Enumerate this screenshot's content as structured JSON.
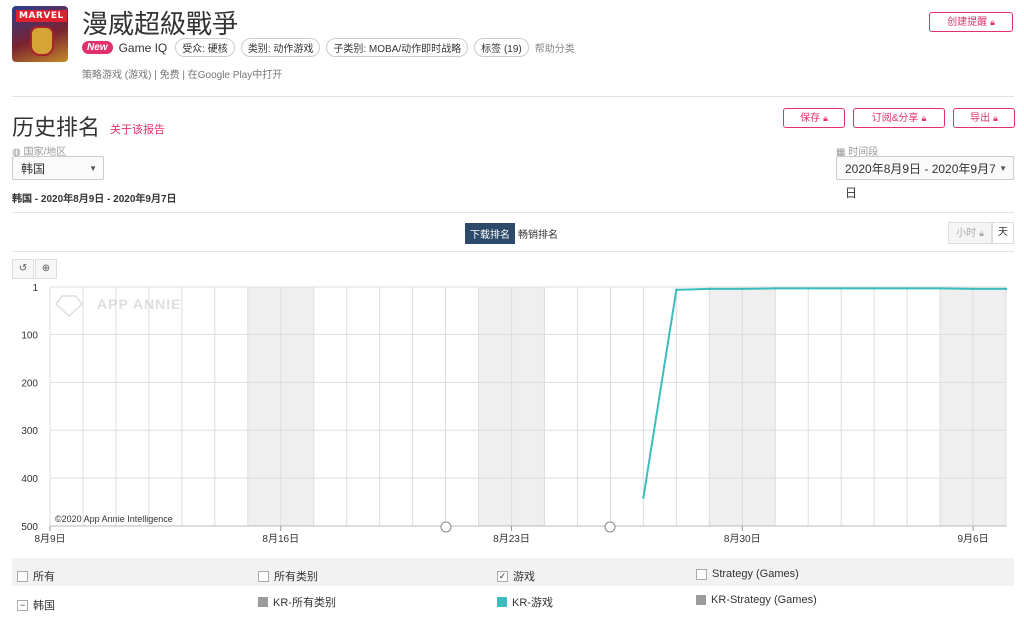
{
  "header": {
    "title": "漫威超級戰爭",
    "new_badge": "New",
    "developer": "Game IQ",
    "pills": [
      "受众: 硬核",
      "类别: 动作游戏",
      "子类别: MOBA/动作即时战略",
      "标签 (19)"
    ],
    "help": "帮助分类",
    "sub_info": "策略游戏 (游戏)  | 免费  | 在Google Play中打开",
    "create_alert": "创建提醒"
  },
  "section": {
    "title": "历史排名",
    "report_link": "关于该报告",
    "save": "保存",
    "subscribe": "订阅&分享",
    "export": "导出",
    "country_label": "国家/地区",
    "country_value": "韩国",
    "period_label": "时间段",
    "period_value": "2020年8月9日 - 2020年9月7日",
    "range_text": "韩国 - 2020年8月9日 - 2020年9月7日",
    "tab_download": "下载排名",
    "tab_grossing": "畅销排名",
    "toggle_hour": "小时",
    "toggle_day": "天"
  },
  "chart_data": {
    "type": "line",
    "watermark": "APP ANNIE",
    "copyright": "©2020 App Annie Intelligence",
    "y_ticks": [
      "1",
      "100",
      "200",
      "300",
      "400",
      "500"
    ],
    "ylim": [
      1,
      500
    ],
    "y_reversed": true,
    "x_ticks": [
      "8月9日",
      "8月16日",
      "8月23日",
      "8月30日",
      "9月6日"
    ],
    "x_tick_days": [
      0,
      7,
      14,
      21,
      28
    ],
    "x_range_days": [
      0,
      29
    ],
    "weekend_days": [
      6,
      7,
      13,
      14,
      20,
      21,
      27,
      28
    ],
    "series": [
      {
        "name": "KR-游戏",
        "color": "#3bbdbe",
        "x": [
          "2020-08-27",
          "2020-08-28",
          "2020-08-29",
          "2020-08-30",
          "2020-08-31",
          "2020-09-01",
          "2020-09-02",
          "2020-09-03",
          "2020-09-04",
          "2020-09-05",
          "2020-09-06",
          "2020-09-07"
        ],
        "values": [
          441,
          7,
          5,
          5,
          4,
          4,
          4,
          4,
          4,
          4,
          5,
          5
        ]
      }
    ]
  },
  "legend": {
    "all": "所有",
    "all_categories": "所有类别",
    "games": "游戏",
    "strategy": "Strategy (Games)",
    "country": "韩国",
    "kr_all": "KR-所有类别",
    "kr_games": "KR-游戏",
    "kr_strategy": "KR-Strategy (Games)",
    "colors": {
      "kr_all": "#9b9b9b",
      "kr_games": "#3bbdbe",
      "kr_strategy": "#9b9b9b"
    }
  }
}
